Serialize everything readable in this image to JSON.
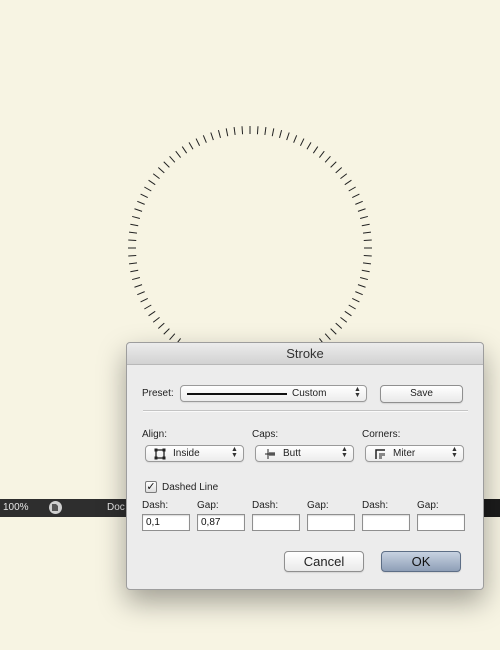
{
  "statusbar": {
    "zoom": "100%",
    "doc_label": "Doc",
    "doc_icon": "document-info-icon"
  },
  "dialog": {
    "title": "Stroke",
    "preset": {
      "label": "Preset:",
      "value": "Custom",
      "save_label": "Save"
    },
    "align": {
      "label": "Align:",
      "value": "Inside",
      "icon": "align-inside-icon"
    },
    "caps": {
      "label": "Caps:",
      "value": "Butt",
      "icon": "cap-butt-icon"
    },
    "corners": {
      "label": "Corners:",
      "value": "Miter",
      "icon": "corner-miter-icon"
    },
    "dashed": {
      "label": "Dashed Line",
      "checked": true
    },
    "dash_fields": [
      {
        "label": "Dash:",
        "value": "0,1"
      },
      {
        "label": "Gap:",
        "value": "0,87"
      },
      {
        "label": "Dash:",
        "value": ""
      },
      {
        "label": "Gap:",
        "value": ""
      },
      {
        "label": "Dash:",
        "value": ""
      },
      {
        "label": "Gap:",
        "value": ""
      }
    ],
    "cancel_label": "Cancel",
    "ok_label": "OK"
  },
  "colors": {
    "canvas": "#f7f4e3",
    "statusbar": "#2e2e2e",
    "dialog": "#ececec",
    "default_button": "#9fb0c8"
  }
}
